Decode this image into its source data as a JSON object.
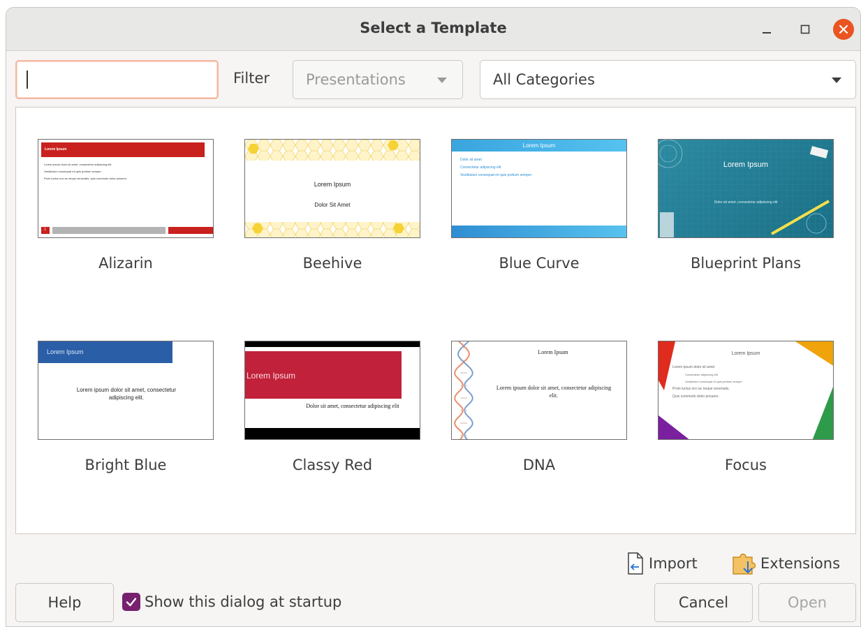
{
  "dialog": {
    "title": "Select a Template"
  },
  "search": {
    "value": ""
  },
  "filter": {
    "label": "Filter",
    "application": "Presentations",
    "category": "All Categories"
  },
  "templates": [
    {
      "name": "Alizarin",
      "preview": {
        "title": "Lorem Ipsum",
        "lines": [
          "Lorem ipsum dolor sit amet, consectetur adipiscing elit.",
          "Vestibulum consequat mi quis pretium semper.",
          "Proin luctus orci ac neque venenatis, quis commodo dolor posuere."
        ],
        "page": "1"
      }
    },
    {
      "name": "Beehive",
      "preview": {
        "title": "Lorem Ipsum",
        "subtitle": "Dolor Sit Amet"
      }
    },
    {
      "name": "Blue Curve",
      "preview": {
        "title": "Lorem Ipsum",
        "bullets": [
          "Dolor sit amet",
          "Consectetur adipiscing elit",
          "Vestibulum consequat mi quis pretium semper"
        ]
      }
    },
    {
      "name": "Blueprint Plans",
      "preview": {
        "title": "Lorem Ipsum",
        "subtitle": "Dolor sit amet, consectetur adipiscing elit"
      }
    },
    {
      "name": "Bright Blue",
      "preview": {
        "title": "Lorem Ipsum",
        "body": "Lorem ipsum dolor sit amet, consectetur adipiscing elit."
      }
    },
    {
      "name": "Classy Red",
      "preview": {
        "title": "Lorem Ipsum",
        "body": "Dolor sit amet, consectetur adipiscing elit"
      }
    },
    {
      "name": "DNA",
      "preview": {
        "title": "Lorem Ipsum",
        "body": "Lorem ipsum dolor sit amet, consectetur adipiscing elit."
      }
    },
    {
      "name": "Focus",
      "preview": {
        "title": "Lorem Ipsum",
        "bullets": [
          "Lorem ipsum dolor sit amet",
          "Consectetur adipiscing elit",
          "Vestibulum consequat mi quis pretium semper",
          "Proin luctus orci ac neque venenatis.",
          "Quis commodo dolor posuere."
        ]
      }
    }
  ],
  "footer": {
    "import": "Import",
    "extensions": "Extensions",
    "help": "Help",
    "show_at_startup": "Show this dialog at startup",
    "cancel": "Cancel",
    "open": "Open"
  },
  "colors": {
    "accent": "#e95420",
    "checkbox": "#77216f"
  },
  "icons": {
    "minimize": "minimize-icon",
    "maximize": "maximize-icon",
    "close": "close-icon",
    "import": "import-icon",
    "extensions": "extensions-icon",
    "dropdown": "chevron-down-icon",
    "check": "checkmark-icon"
  }
}
